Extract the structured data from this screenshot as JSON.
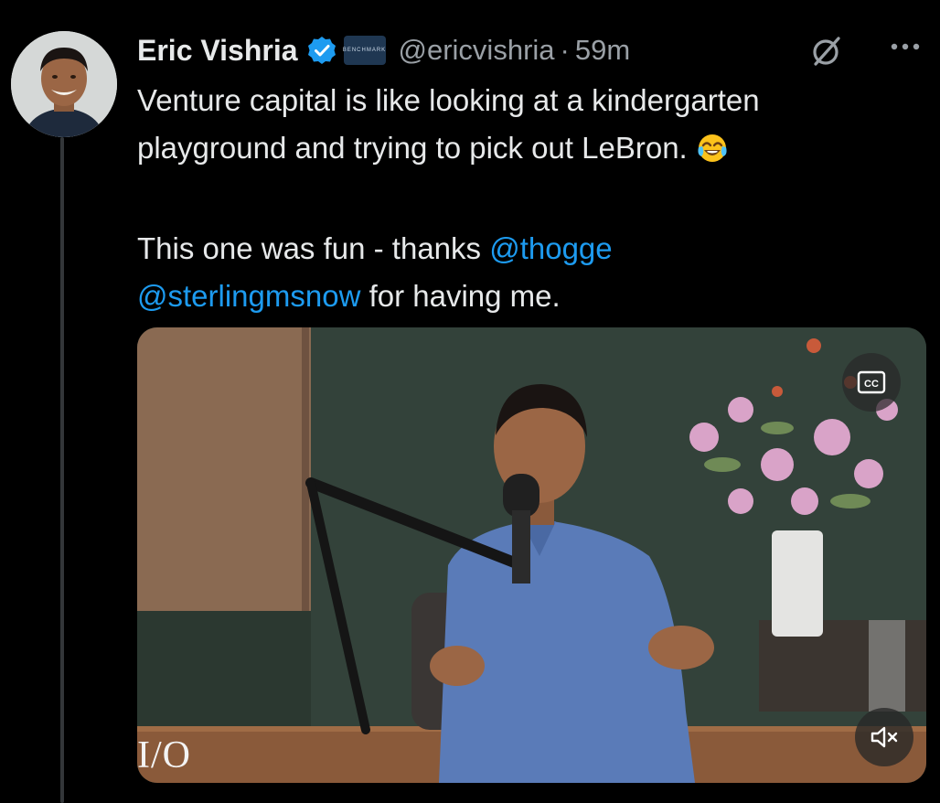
{
  "tweet": {
    "display_name": "Eric Vishria",
    "handle": "@ericvishria",
    "separator": "·",
    "time": "59m",
    "affiliation_badge_text": "BENCHMARK",
    "text": {
      "line1": "Venture capital is like looking at a kindergarten",
      "line2": "playground and trying to pick out LeBron.",
      "line3_prefix": "This one was fun - thanks ",
      "mention1": "@thogge",
      "mention2": "@sterlingmsnow",
      "line4_suffix": " for having me."
    }
  },
  "media": {
    "type": "video",
    "watermark": "I/O",
    "cc_label": "CC"
  },
  "icons": {
    "verified": "verified-badge-icon",
    "grok": "grok-icon",
    "more": "more-icon",
    "emoji": "face-with-tears-of-joy-icon",
    "captions": "closed-captions-icon",
    "mute": "muted-speaker-icon"
  },
  "colors": {
    "background": "#000000",
    "text": "#e7e9ea",
    "muted": "#9aa0a6",
    "link": "#1d9bf0",
    "verified": "#1d9bf0",
    "thread_line": "#333639"
  }
}
